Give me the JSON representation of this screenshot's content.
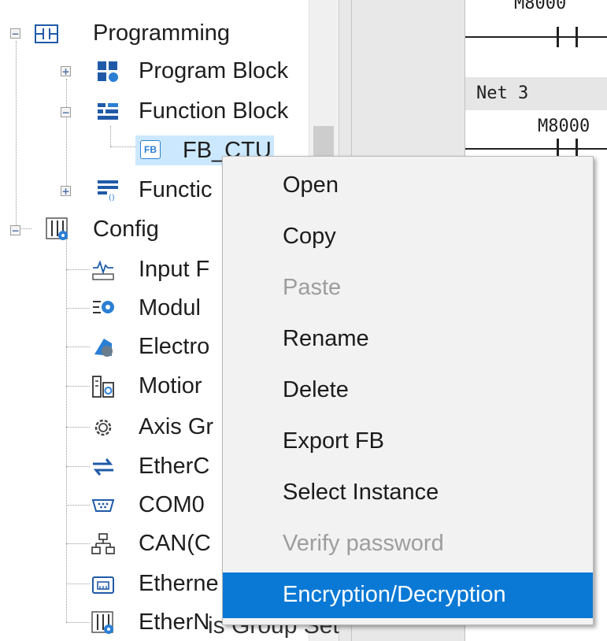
{
  "tree": {
    "items": [
      {
        "label": "Programming",
        "expander": "−"
      },
      {
        "label": "Program Block",
        "expander": "+"
      },
      {
        "label": "Function Block",
        "expander": "−"
      },
      {
        "label": "FB_CTU",
        "badge": "FB"
      },
      {
        "label": "Functic",
        "expander": "+"
      },
      {
        "label": "Config",
        "expander": "−"
      },
      {
        "label": "Input F"
      },
      {
        "label": "Modul"
      },
      {
        "label": "Electro"
      },
      {
        "label": "Motior"
      },
      {
        "label": "Axis Gr"
      },
      {
        "label": "EtherC"
      },
      {
        "label": "COM0"
      },
      {
        "label": "CAN(C"
      },
      {
        "label": "Etherne"
      },
      {
        "label": "EtherN"
      }
    ]
  },
  "editor": {
    "contact_top": "M8000",
    "net_label": "Net 3",
    "contact_mid": "M8000",
    "bottom_fragment": "is Group Set"
  },
  "context_menu": {
    "items": [
      {
        "label": "Open",
        "enabled": true
      },
      {
        "label": "Copy",
        "enabled": true
      },
      {
        "label": "Paste",
        "enabled": false
      },
      {
        "label": "Rename",
        "enabled": true
      },
      {
        "label": "Delete",
        "enabled": true
      },
      {
        "label": "Export FB",
        "enabled": true
      },
      {
        "label": "Select Instance",
        "enabled": true
      },
      {
        "label": "Verify password",
        "enabled": false
      },
      {
        "label": "Encryption/Decryption",
        "enabled": true,
        "highlighted": true
      }
    ]
  },
  "colors": {
    "highlight": "#0a79d6",
    "selected_row": "#cce8ff",
    "icon_blue": "#1f5aa8",
    "gear_blue": "#2a7fd4"
  }
}
